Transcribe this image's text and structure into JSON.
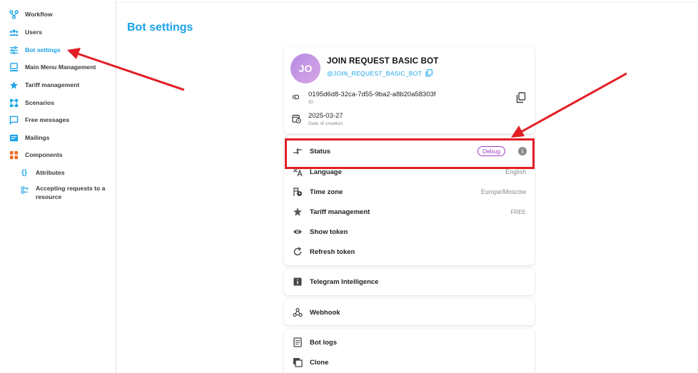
{
  "sidebar": {
    "items": [
      {
        "label": "Workflow",
        "icon": "workflow-icon"
      },
      {
        "label": "Users",
        "icon": "users-icon"
      },
      {
        "label": "Bot settings",
        "icon": "sliders-icon",
        "active": true
      },
      {
        "label": "Main Menu Management",
        "icon": "menu-icon"
      },
      {
        "label": "Tariff management",
        "icon": "tariff-icon"
      },
      {
        "label": "Scenarios",
        "icon": "scenarios-icon"
      },
      {
        "label": "Free messages",
        "icon": "message-icon"
      },
      {
        "label": "Mailings",
        "icon": "mailings-icon"
      },
      {
        "label": "Components",
        "icon": "components-icon"
      }
    ],
    "sub_items": [
      {
        "label": "Attributes",
        "icon": "braces-icon",
        "glyph": "{}"
      },
      {
        "label": "Accepting requests to a resource",
        "icon": "key-icon"
      }
    ]
  },
  "page": {
    "title": "Bot settings"
  },
  "bot": {
    "avatar_initials": "JO",
    "name": "JOIN REQUEST BASIC BOT",
    "handle": "@JOIN_REQUEST_BASIC_BOT",
    "id_value": "0195d6d8-32ca-7d55-9ba2-a8b20a58303f",
    "id_caption": "ID",
    "created_value": "2025-03-27",
    "created_caption": "Date of creation"
  },
  "settings": {
    "status_label": "Status",
    "status_value": "Debug",
    "language_label": "Language",
    "language_value": "English",
    "timezone_label": "Time zone",
    "timezone_value": "Europe/Moscow",
    "tariff_label": "Tariff management",
    "tariff_value": "FREE",
    "show_token_label": "Show token",
    "refresh_token_label": "Refresh token"
  },
  "cards": {
    "telegram_intelligence": "Telegram Intelligence",
    "webhook": "Webhook",
    "bot_logs": "Bot logs",
    "clone": "Clone"
  },
  "colors": {
    "accent": "#1aa3e8",
    "highlight": "#e31e24",
    "debug_badge": "#a03ec9"
  }
}
